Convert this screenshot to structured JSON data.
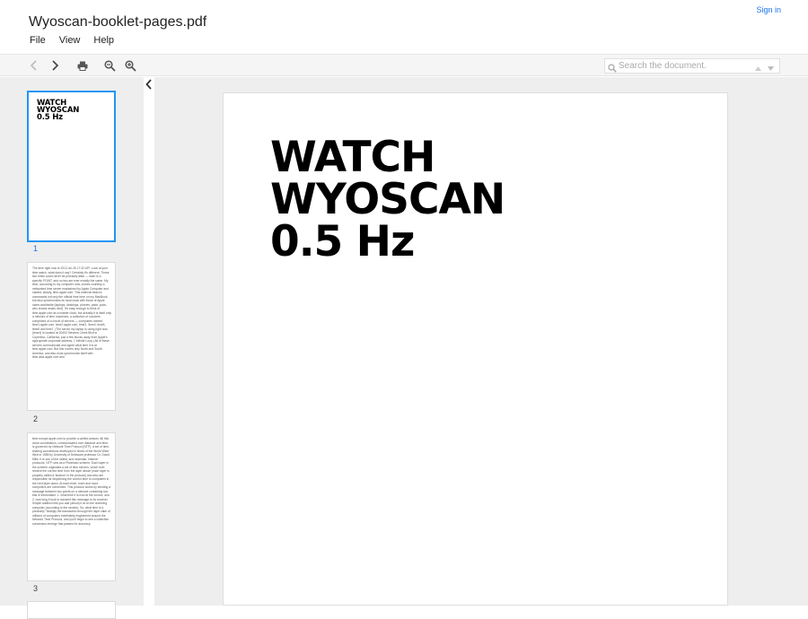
{
  "header": {
    "title": "Wyoscan-booklet-pages.pdf",
    "menu": [
      "File",
      "View",
      "Help"
    ],
    "sign_in": "Sign in"
  },
  "toolbar": {
    "icons": [
      "chevron-left-icon",
      "chevron-right-icon",
      "print-icon",
      "zoom-out-icon",
      "zoom-in-icon"
    ],
    "search_placeholder": "Search the document."
  },
  "thumbnails": [
    {
      "page": "1",
      "title_lines": [
        "WATCH",
        "WYOSCAN",
        "0.5 Hz"
      ],
      "active": true
    },
    {
      "page": "2",
      "text": "The time right now is 2012-Jul-26 17:32 API. Look at your time watch, what does it say? Certainly it's different. These two times could never be precisely alike — each is a specific POINT, and no two are ever exactly the same. My time, according to my computer now, comes courtesy a networked time server maintained by Apple Computer and named, simply, time.apple.com. This external beacon commands not only the official time here on my MacBook, but also synchronizes its local clock with those of Apple users worldwide (laptops, desktops, phones, pads, pods, who knows whats next). It's easy enough to think of time.apple.com as a master clock, but actually it is itself only a network of time machines, a collection of counters comprised of a circuit of servers — computers named time1.apple.com, time2.apple.com, time3, 'time4, time5, time6 and time7. (The server my laptop is using right now (time4) is located at 20400 Stevens Creek Blvd in Cupertino, California, just a few blocks away from Apple's appropriate corporate address, 1 Infinite Loop.) All of these servers communicate and agree what time it is at time.apple.com. But this covers only North and South America, and also must synchronize itself with time.asia.apple.com and"
    },
    {
      "page": "3",
      "text": "time.europe.apple.com to provide a unified answer. All this close coordination, communicated over distance and time, is governed by Network Time Protocol (NTP), a set of time-sharing conventions developed in slices of the World Wide Web in 1985 by University of Delaware professor Dr. David Mills. It is one of the oldest, and essential, Internet protocols. NTP runs as a Ptolemaic scheme. Each layer in the scheme originates a set of time servers, which both receive the correct time from the layer above (each layer is properly called a 'stratum' in the protocol) and also are responsible for dispensing the correct time to computers in the next layer down. At each level, more and more computers are connected. This protocol works by sending a message between two points on a network containing two bits of information: 1. what time it is now at the source, and 2. how long it took to transmit this message to its receiver. Simple addition lets you add (about) it at on the receiving computer (according to the sender). So, what time is it, precisely? Multiply the transaction through the layer cake of millions of computers indefinitely engineered around the Network Time Protocol, and you'll begin to see a collective consensus emerge that passes for accuracy."
    }
  ],
  "document": {
    "title_lines": [
      "WATCH",
      "WYOSCAN",
      "0.5 Hz"
    ]
  }
}
